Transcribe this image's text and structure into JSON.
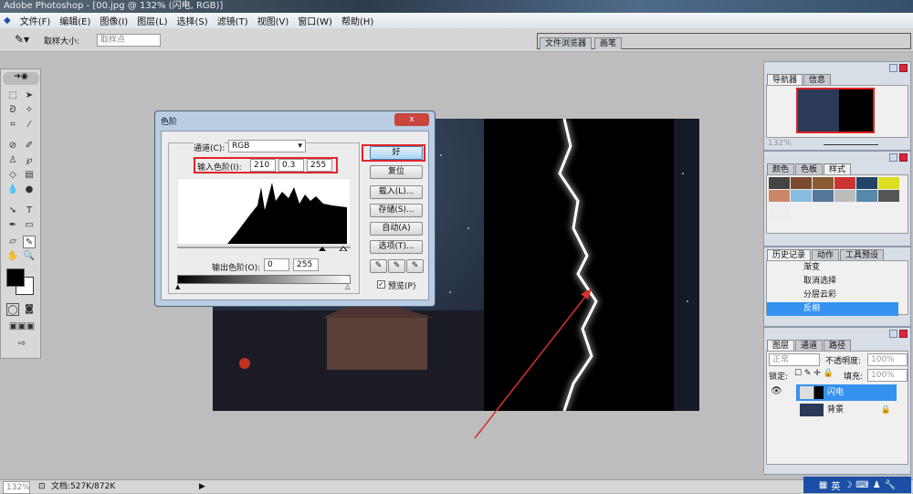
{
  "title": "Adobe Photoshop - [00.jpg @ 132% (闪电, RGB)]",
  "menu": [
    "文件(F)",
    "编辑(E)",
    "图像(I)",
    "图层(L)",
    "选择(S)",
    "滤镜(T)",
    "视图(V)",
    "窗口(W)",
    "帮助(H)"
  ],
  "options": {
    "sample_size_label": "取样大小:",
    "sample_size_value": "取样点",
    "tabs": [
      "文件浏览器",
      "画笔"
    ]
  },
  "dialog": {
    "title": "色阶",
    "channel_label": "通道(C):",
    "channel_value": "RGB",
    "input_label": "输入色阶(I):",
    "input_values": [
      "210",
      "0.3",
      "255"
    ],
    "output_label": "输出色阶(O):",
    "output_values": [
      "0",
      "255"
    ],
    "buttons": [
      "好",
      "复位",
      "载入(L)...",
      "存储(S)...",
      "自动(A)",
      "选项(T)..."
    ],
    "preview_label": "预览(P)",
    "preview_checked": true,
    "close": "x"
  },
  "navigator": {
    "tabs": [
      "导航器",
      "信息"
    ],
    "zoom": "132%"
  },
  "styles": {
    "tabs": [
      "颜色",
      "色板",
      "样式"
    ]
  },
  "history": {
    "tabs": [
      "历史记录",
      "动作",
      "工具预设"
    ],
    "items": [
      "渐变",
      "取消选择",
      "分层云彩",
      "反相"
    ],
    "selected": 3
  },
  "layers": {
    "tabs": [
      "图层",
      "通道",
      "路径"
    ],
    "mode": "正常",
    "opacity_label": "不透明度:",
    "opacity": "100%",
    "lock_label": "锁定:",
    "fill_label": "填充:",
    "fill": "100%",
    "items": [
      "闪电",
      "背景"
    ],
    "selected": 0
  },
  "status": {
    "zoom": "132%",
    "doc": "文档:527K/872K"
  },
  "tray": [
    "英"
  ],
  "colors": {
    "highlight": "#e0262c",
    "selection": "#3592f0"
  }
}
